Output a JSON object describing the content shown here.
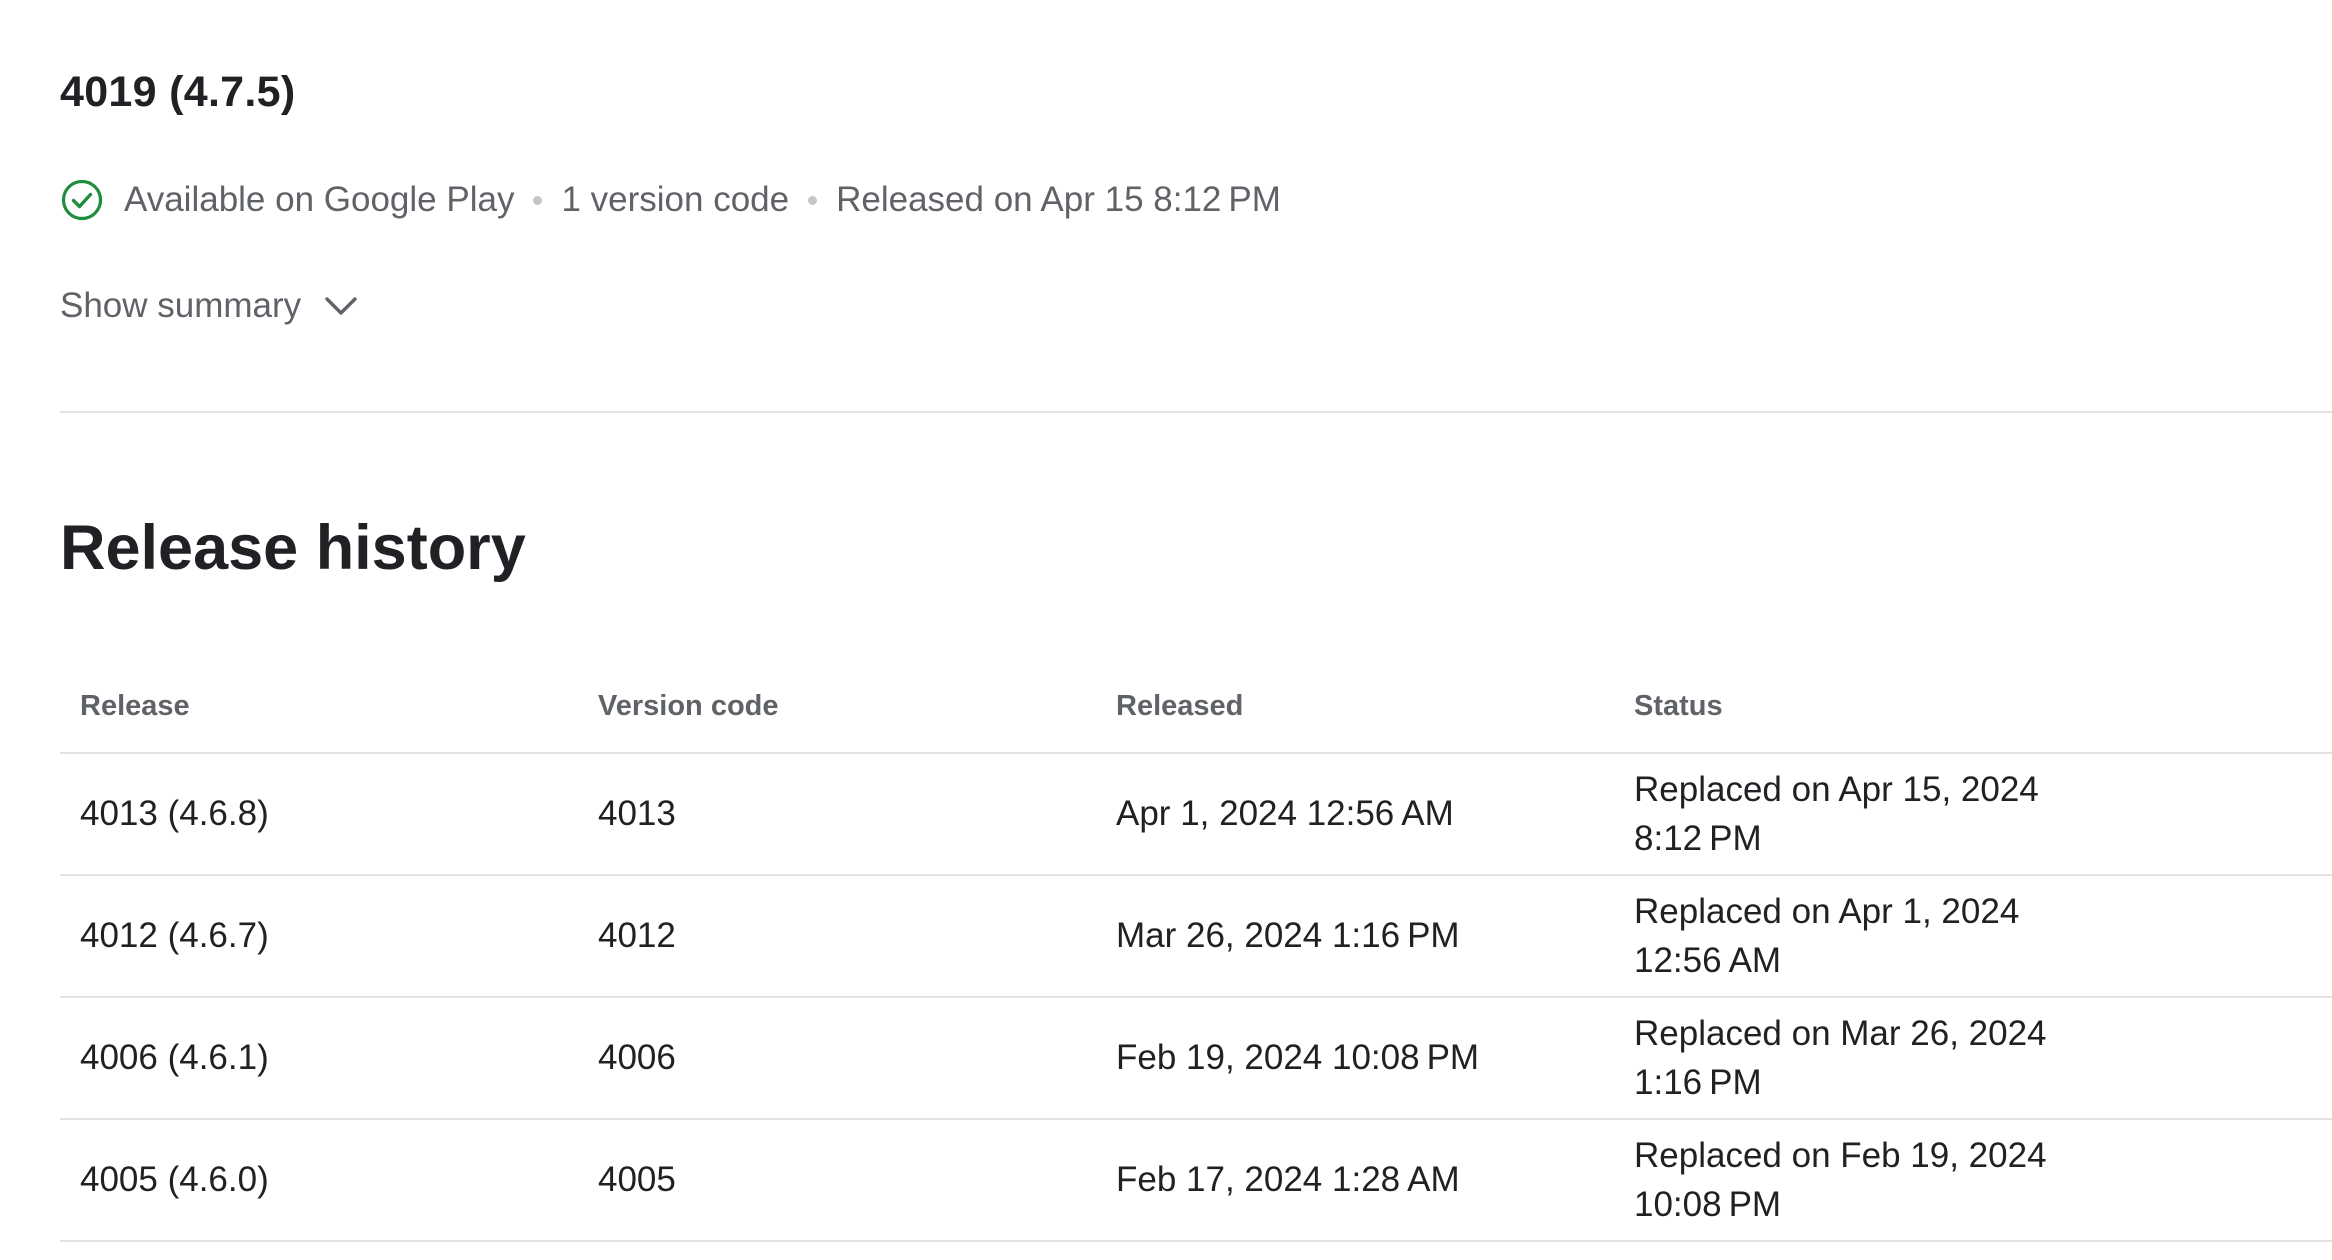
{
  "release": {
    "title": "4019 (4.7.5)",
    "status": "Available on Google Play",
    "version_codes": "1 version code",
    "released": "Released on Apr 15 8:12 PM",
    "status_icon": "check-circle-icon",
    "status_color": "#1e8e3e"
  },
  "summary_toggle": {
    "label": "Show summary",
    "icon": "chevron-down-icon"
  },
  "history": {
    "title": "Release history",
    "columns": [
      "Release",
      "Version code",
      "Released",
      "Status"
    ],
    "rows": [
      {
        "release": "4013 (4.6.8)",
        "version_code": "4013",
        "released": "Apr 1, 2024 12:56 AM",
        "status": "Replaced on Apr 15, 2024 8:12 PM"
      },
      {
        "release": "4012 (4.6.7)",
        "version_code": "4012",
        "released": "Mar 26, 2024 1:16 PM",
        "status": "Replaced on Apr 1, 2024 12:56 AM"
      },
      {
        "release": "4006 (4.6.1)",
        "version_code": "4006",
        "released": "Feb 19, 2024 10:08 PM",
        "status": "Replaced on Mar 26, 2024 1:16 PM"
      },
      {
        "release": "4005 (4.6.0)",
        "version_code": "4005",
        "released": "Feb 17, 2024 1:28 AM",
        "status": "Replaced on Feb 19, 2024 10:08 PM"
      }
    ]
  }
}
